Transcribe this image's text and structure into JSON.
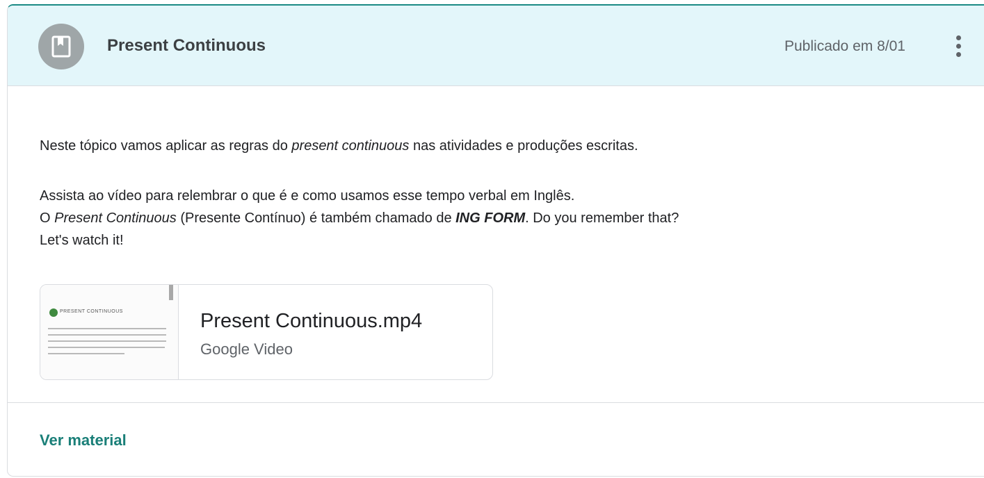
{
  "header": {
    "title": "Present Continuous",
    "published": "Publicado em 8/01",
    "avatar_icon": "book-icon",
    "menu_icon": "more-vert-icon"
  },
  "description": {
    "line1": {
      "before": "Neste tópico vamos aplicar as regras do ",
      "italic": "present continuous",
      "after": " nas atividades e produções escritas."
    },
    "line2": "Assista ao vídeo para relembrar o que é e como usamos esse tempo verbal em Inglês.",
    "line3": {
      "prefix": "O ",
      "italic": "Present Continuous",
      "middle": " (Presente Contínuo) é também chamado de ",
      "bold_italic": "ING FORM",
      "suffix": ". Do you remember that?"
    },
    "line4": "Let's watch it!"
  },
  "attachment": {
    "title": "Present Continuous.mp4",
    "subtitle": "Google Video",
    "thumbnail_heading": "PRESENT CONTINUOUS"
  },
  "footer": {
    "link": "Ver material"
  },
  "colors": {
    "header_bg": "#e3f6fa",
    "accent": "#1a7f78",
    "avatar_bg": "#9fa6a8"
  }
}
